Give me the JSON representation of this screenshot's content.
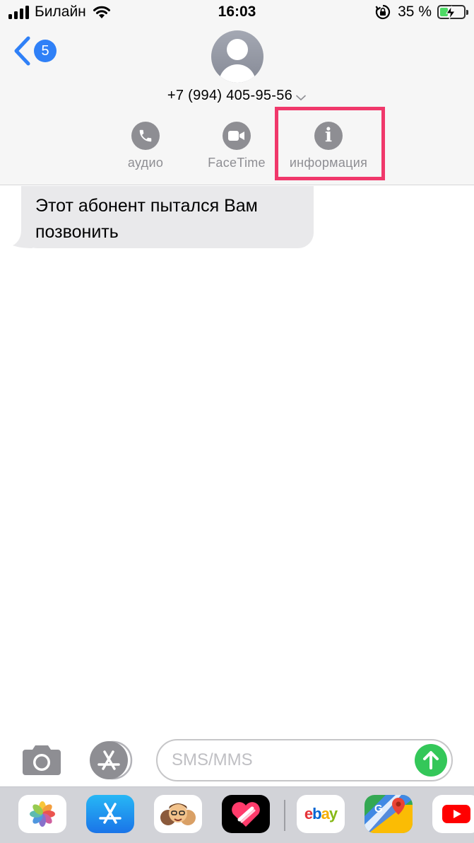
{
  "status": {
    "carrier": "Билайн",
    "time": "16:03",
    "battery_percent": "35 %",
    "battery_level": 0.35
  },
  "nav": {
    "back_count": "5"
  },
  "contact": {
    "phone": "+7 (994) 405-95-56"
  },
  "actions": [
    {
      "label": "аудио",
      "icon": "phone-icon"
    },
    {
      "label": "FaceTime",
      "icon": "video-camera-icon"
    },
    {
      "label": "информация",
      "icon": "info-icon",
      "highlighted": true
    }
  ],
  "messages": [
    {
      "direction": "incoming",
      "text": "Этот абонент пытался Вам позвонить"
    }
  ],
  "compose": {
    "placeholder": "SMS/MMS",
    "value": ""
  },
  "app_drawer": [
    {
      "name": "photos-app-icon"
    },
    {
      "name": "app-store-app-icon"
    },
    {
      "name": "memoji-app-icon"
    },
    {
      "name": "digital-touch-app-icon"
    },
    {
      "name": "ebay-app-icon",
      "label": "ebay"
    },
    {
      "name": "google-maps-app-icon",
      "label": "G"
    },
    {
      "name": "youtube-app-icon"
    }
  ],
  "colors": {
    "accent_blue": "#2f80f7",
    "send_green": "#34c759",
    "highlight_pink": "#f0386b",
    "bubble_gray": "#e9e9eb",
    "label_gray": "#8e8e93"
  }
}
